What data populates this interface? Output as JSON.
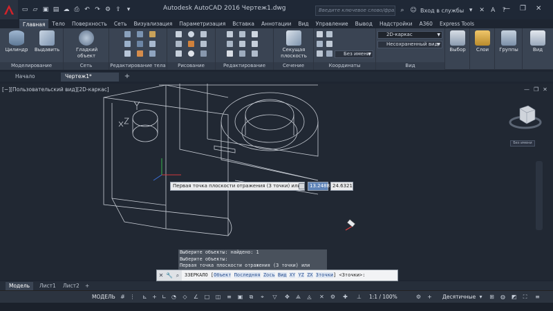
{
  "window": {
    "title": "Autodesk AutoCAD 2016   Чертеж1.dwg",
    "search_placeholder": "Введите ключевое слово/фразу",
    "signin_label": "Вход в службы",
    "help_label": "?"
  },
  "menu_tabs": [
    "Главная",
    "Тело",
    "Поверхность",
    "Сеть",
    "Визуализация",
    "Параметризация",
    "Вставка",
    "Аннотации",
    "Вид",
    "Управление",
    "Вывод",
    "Надстройки",
    "A360",
    "Express Tools"
  ],
  "ribbon": {
    "panels": {
      "modeling": "Моделирование",
      "mesh": "Сеть",
      "solid_edit": "Редактирование тела",
      "draw": "Рисование",
      "modify": "Редактирование",
      "section": "Сечение",
      "coordinates": "Координаты",
      "view": "Вид"
    },
    "buttons": {
      "cylinder": "Цилиндр",
      "extrude": "Выдавить",
      "smooth_object": "Гладкий объект",
      "section_plane": "Секущая плоскость",
      "selection": "Выбор",
      "layers": "Слои",
      "groups": "Группы",
      "view": "Вид"
    },
    "visual_style": "2D-каркас",
    "view_state": "Несохраненный вид",
    "ucs_name": "Без имени"
  },
  "doc_tabs": [
    "Начало",
    "Чертеж1*"
  ],
  "viewport": {
    "label": "[−][Пользовательский вид][2D-каркас]",
    "viewcube_label": "Без имени"
  },
  "dynamic_input": {
    "prompt": "Первая точка плоскости отражения (3 точки) или",
    "x_value": "13.2488",
    "y_value": "24.6321"
  },
  "command_history": [
    "Выберите объекты: найдено: 1",
    "Выберите объекты:",
    "Первая точка плоскости отражения (3 точки) или"
  ],
  "command_line": {
    "command": "ЗЗЕРКАЛО",
    "options": [
      "Объект",
      "Последняя",
      "Zось",
      "Вид",
      "XY",
      "YZ",
      "ZX",
      "3точки"
    ],
    "default": "<3точки>:"
  },
  "layout_tabs": [
    "Модель",
    "Лист1",
    "Лист2"
  ],
  "status": {
    "model": "МОДЕЛЬ",
    "scale": "1:1 / 100%",
    "units": "Десятичные"
  }
}
